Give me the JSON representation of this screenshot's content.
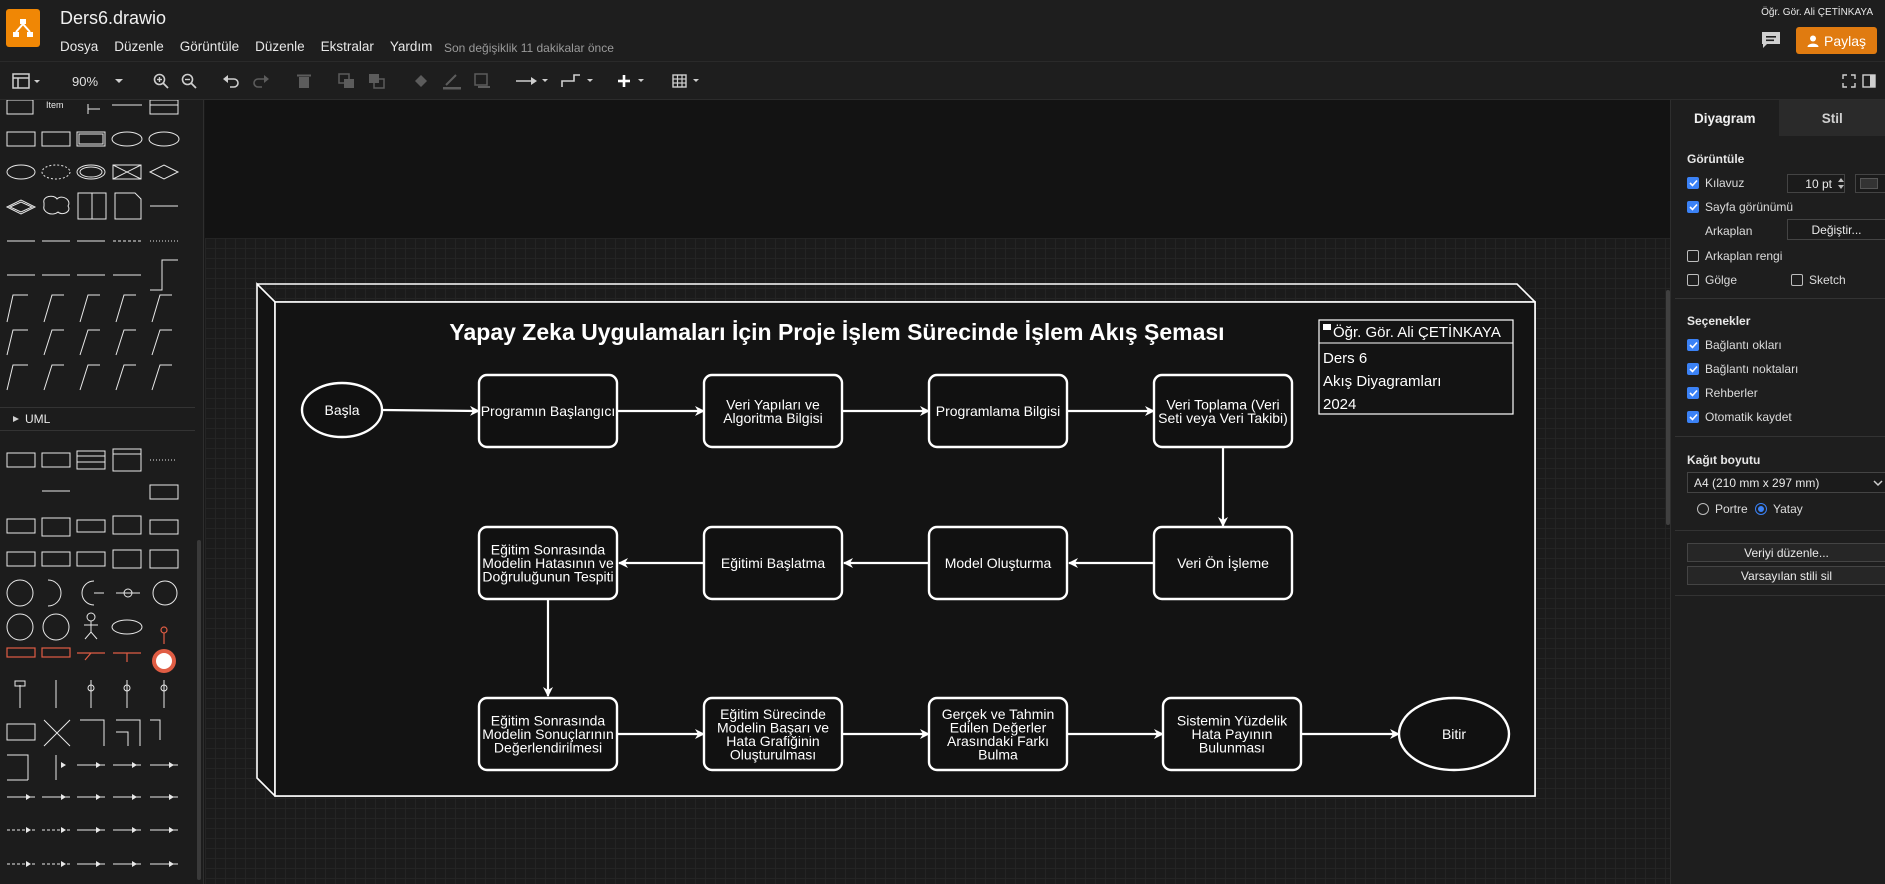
{
  "header": {
    "file_title": "Ders6.drawio",
    "menu": [
      "Dosya",
      "Düzenle",
      "Görüntüle",
      "Düzenle",
      "Ekstralar",
      "Yardım"
    ],
    "last_change": "Son değişiklik 11 dakikalar önce",
    "user_name": "Öğr. Gör. Ali ÇETİNKAYA",
    "share_label": "Paylaş"
  },
  "toolbar": {
    "zoom": "90%"
  },
  "left_panel": {
    "shape_item_label": "Item",
    "uml_title": "UML"
  },
  "diagram": {
    "title": "Yapay Zeka Uygulamaları İçin Proje İşlem Sürecinde İşlem Akış Şeması",
    "info_box": {
      "author": "Öğr. Gör. Ali ÇETİNKAYA",
      "lines": [
        "Ders 6",
        "Akış Diyagramları",
        "2024"
      ]
    },
    "nodes": {
      "start": [
        "Başla"
      ],
      "n1": [
        "Programın Başlangıcı"
      ],
      "n2": [
        "Veri Yapıları ve",
        "Algoritma Bilgisi"
      ],
      "n3": [
        "Programlama Bilgisi"
      ],
      "n4": [
        "Veri Toplama (Veri",
        "Seti veya Veri Takibi)"
      ],
      "n5": [
        "Veri Ön İşleme"
      ],
      "n6": [
        "Model Oluşturma"
      ],
      "n7": [
        "Eğitimi Başlatma"
      ],
      "n8": [
        "Eğitim Sonrasında",
        "Modelin Hatasının ve",
        "Doğruluğunun Tespiti"
      ],
      "n9": [
        "Eğitim Sonrasında",
        "Modelin Sonuçlarının",
        "Değerlendirilmesi"
      ],
      "n10": [
        "Eğitim Sürecinde",
        "Modelin Başarı ve",
        "Hata Grafiğinin",
        "Oluşturulması"
      ],
      "n11": [
        "Gerçek ve Tahmin",
        "Edilen Değerler",
        "Arasındaki Farkı",
        "Bulma"
      ],
      "n12": [
        "Sistemin Yüzdelik",
        "Hata Payının",
        "Bulunması"
      ],
      "end": [
        "Bitir"
      ]
    }
  },
  "right_panel": {
    "tabs": [
      "Diyagram",
      "Stil"
    ],
    "view_title": "Görüntüle",
    "grid_label": "Kılavuz",
    "grid_size": "10 pt",
    "page_view_label": "Sayfa görünümü",
    "background_label": "Arkaplan",
    "change_button": "Değiştir...",
    "background_color_label": "Arkaplan rengi",
    "shadow_label": "Gölge",
    "sketch_label": "Sketch",
    "options_title": "Seçenekler",
    "options": [
      {
        "label": "Bağlantı okları",
        "checked": true
      },
      {
        "label": "Bağlantı noktaları",
        "checked": true
      },
      {
        "label": "Rehberler",
        "checked": true
      },
      {
        "label": "Otomatik kaydet",
        "checked": true
      }
    ],
    "paper_title": "Kağıt boyutu",
    "paper_size": "A4 (210 mm x 297 mm)",
    "portrait_label": "Portre",
    "landscape_label": "Yatay",
    "edit_data_button": "Veriyi düzenle...",
    "clear_style_button": "Varsayılan stili sil"
  },
  "colors": {
    "accent": "#e07b10",
    "checkbox": "#3b82f6",
    "canvas_bg": "#1b1b1b"
  }
}
